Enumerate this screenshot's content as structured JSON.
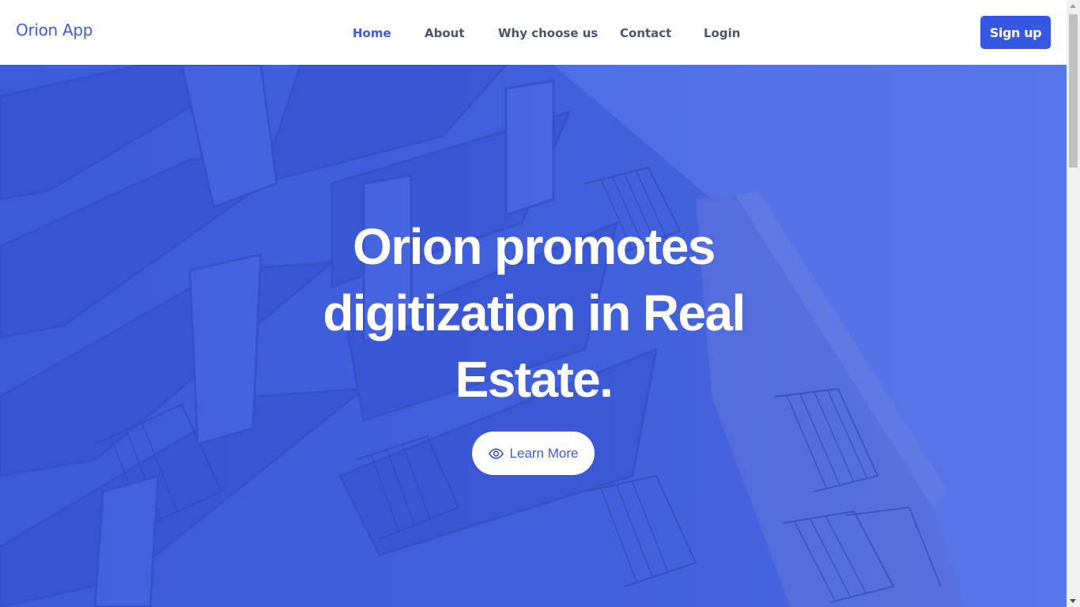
{
  "brand": {
    "name": "Orion App"
  },
  "nav": {
    "items": [
      {
        "label": "Home",
        "active": true
      },
      {
        "label": "About",
        "active": false
      },
      {
        "label": "Why choose us",
        "active": false
      },
      {
        "label": "Contact",
        "active": false
      },
      {
        "label": "Login",
        "active": false
      }
    ]
  },
  "header": {
    "signup_label": "Sign up"
  },
  "hero": {
    "title": "Orion promotes digitization in Real Estate.",
    "cta_label": "Learn More",
    "cta_icon": "eye-icon",
    "background": "apartment-building-photo"
  },
  "colors": {
    "brand": "#3d5bd9",
    "primary_button": "#3458e3",
    "nav_text": "#4a5573",
    "hero_overlay": "#4262dc",
    "hero_text": "#ffffff"
  }
}
